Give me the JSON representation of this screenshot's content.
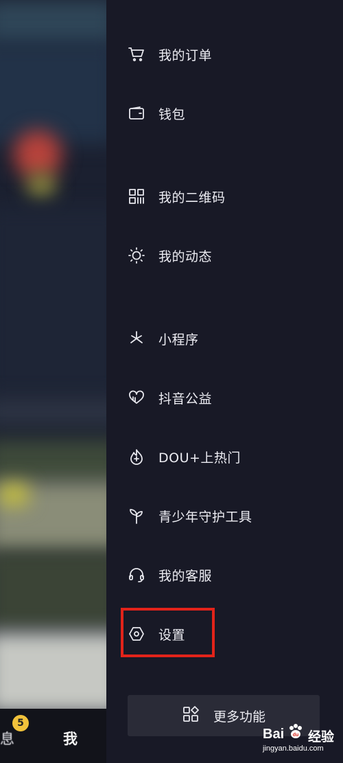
{
  "menu": {
    "items": [
      {
        "id": "orders",
        "label": "我的订单",
        "icon": "cart-icon"
      },
      {
        "id": "wallet",
        "label": "钱包",
        "icon": "wallet-icon"
      },
      {
        "id": "qrcode",
        "label": "我的二维码",
        "icon": "qrcode-icon"
      },
      {
        "id": "moments",
        "label": "我的动态",
        "icon": "sun-icon"
      },
      {
        "id": "miniprogram",
        "label": "小程序",
        "icon": "asterisk-icon"
      },
      {
        "id": "charity",
        "label": "抖音公益",
        "icon": "heart-icon"
      },
      {
        "id": "douplus",
        "label": "DOU+上热门",
        "icon": "flame-plus-icon"
      },
      {
        "id": "youth",
        "label": "青少年守护工具",
        "icon": "sprout-icon"
      },
      {
        "id": "service",
        "label": "我的客服",
        "icon": "headset-icon"
      },
      {
        "id": "settings",
        "label": "设置",
        "icon": "hexagon-gear-icon"
      }
    ],
    "more_label": "更多功能"
  },
  "bottom_nav": {
    "messages_label": "息",
    "messages_badge": "5",
    "me_label": "我"
  },
  "watermark": {
    "logo_text": "Bai",
    "logo_text2": "经验",
    "url": "jingyan.baidu.com"
  },
  "colors": {
    "panel_bg": "#181926",
    "highlight": "#e2231a",
    "badge": "#f2c23b"
  }
}
